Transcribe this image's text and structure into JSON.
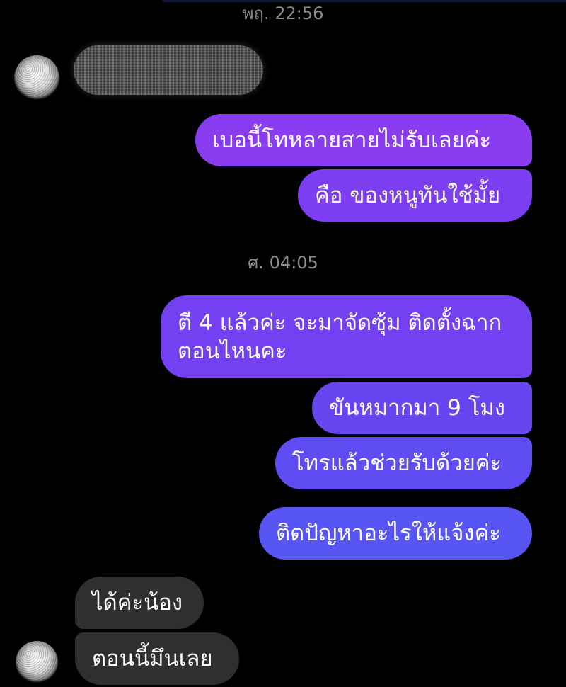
{
  "thread": {
    "timestamps": [
      "พฤ. 22:56",
      "ศ. 04:05"
    ],
    "outgoing_group_1": [
      "เบอนี้โทหลายสายไม่รับเลยค่ะ",
      "คือ ของหนูทันใช้มั้ย"
    ],
    "outgoing_group_2": {
      "first_line_1": "ตี 4 แล้วค่ะ จะมาจัดซุ้ม ติดตั้งฉาก",
      "first_line_2": "ตอนไหนคะ",
      "second": "ขันหมากมา 9 โมง",
      "third": "โทรแล้วช่วยรับด้วยค่ะ"
    },
    "outgoing_single": "ติดปัญหาอะไรให้แจ้งค่ะ",
    "incoming": [
      "ได้ค่ะน้อง",
      "ตอนนี้มึนเลย"
    ]
  },
  "colors": {
    "background": "#000000",
    "incoming_bubble": "#2f2f31",
    "outgoing_top": "#8a3cf0",
    "outgoing_mid": "#6a47f2",
    "outgoing_bottom": "#5a55f3",
    "timestamp": "#8e8e93"
  },
  "icons": {
    "contact_avatar": "avatar-icon",
    "redacted_message": "blurred-message"
  }
}
